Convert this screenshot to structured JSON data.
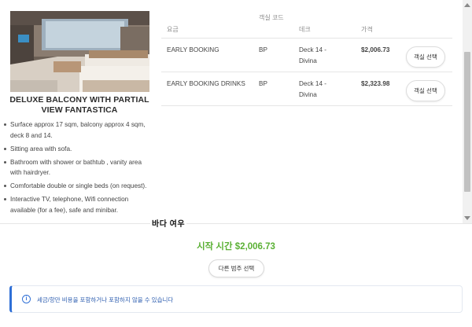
{
  "cabin": {
    "title": "DELUXE BALCONY WITH PARTIAL VIEW FANTASTICA",
    "features": [
      "Surface approx 17 sqm, balcony approx 4 sqm, deck 8 and 14.",
      "Sitting area with sofa.",
      "Bathroom with shower or bathtub , vanity area with hairdryer.",
      "Comfortable double or single beds (on request).",
      "Interactive TV, telephone, Wifi connection available (for a fee), safe and minibar."
    ]
  },
  "fare_table": {
    "headers": {
      "fare": "요금",
      "cabin_code": "객실 코드",
      "deck": "데크",
      "price": "가격"
    },
    "rows": [
      {
        "fare": "EARLY BOOKING",
        "cabin_code": "BP",
        "deck": "Deck 14 - Divina",
        "price": "$2,006.73",
        "button": "객실 선택"
      },
      {
        "fare": "EARLY BOOKING DRINKS",
        "cabin_code": "BP",
        "deck": "Deck 14 - Divina",
        "price": "$2,323.98",
        "button": "객실 선택"
      }
    ]
  },
  "footer": {
    "ocean_label": "바다 여우",
    "start_price": "시작 시간 $2,006.73",
    "other_category_button": "다른 범주 선택",
    "notice": "세금/항만 비용을 포함하거나 포함하지 않을 수 있습니다"
  },
  "colors": {
    "price_green": "#5ab034",
    "info_blue": "#2f6fd6"
  },
  "icons": {
    "notice": "info-icon"
  }
}
